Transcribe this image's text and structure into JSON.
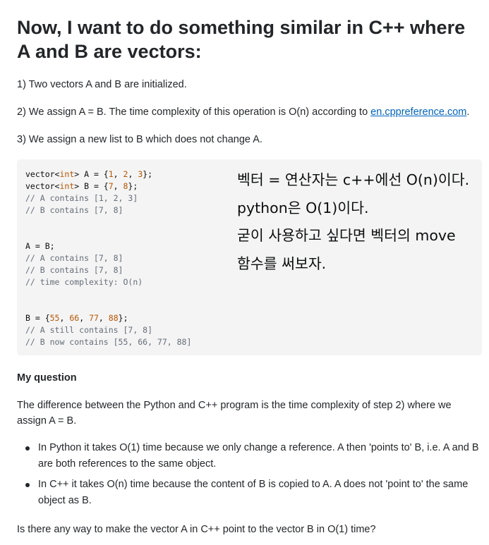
{
  "post": {
    "heading": "Now, I want to do something similar in C++ where A and B are vectors:",
    "steps": [
      "1) Two vectors A and B are initialized.",
      "2) We assign A = B. The time complexity of this operation is O(n) according to ",
      "3) We assign a new list to B which does not change A."
    ],
    "step2_link": "en.cppreference.com",
    "step2_suffix": ".",
    "code_lines": [
      [
        {
          "t": "vector<",
          "c": ""
        },
        {
          "t": "int",
          "c": "kw"
        },
        {
          "t": "> A = {",
          "c": ""
        },
        {
          "t": "1",
          "c": "num"
        },
        {
          "t": ", ",
          "c": ""
        },
        {
          "t": "2",
          "c": "num"
        },
        {
          "t": ", ",
          "c": ""
        },
        {
          "t": "3",
          "c": "num"
        },
        {
          "t": "};",
          "c": ""
        }
      ],
      [
        {
          "t": "vector<",
          "c": ""
        },
        {
          "t": "int",
          "c": "kw"
        },
        {
          "t": "> B = {",
          "c": ""
        },
        {
          "t": "7",
          "c": "num"
        },
        {
          "t": ", ",
          "c": ""
        },
        {
          "t": "8",
          "c": "num"
        },
        {
          "t": "};",
          "c": ""
        }
      ],
      [
        {
          "t": "// A contains [1, 2, 3]",
          "c": "cm"
        }
      ],
      [
        {
          "t": "// B contains [7, 8]",
          "c": "cm"
        }
      ],
      [],
      [],
      [
        {
          "t": "A = B;",
          "c": ""
        }
      ],
      [
        {
          "t": "// A contains [7, 8]",
          "c": "cm"
        }
      ],
      [
        {
          "t": "// B contains [7, 8]",
          "c": "cm"
        }
      ],
      [
        {
          "t": "// time complexity: O(n)",
          "c": "cm"
        }
      ],
      [],
      [],
      [
        {
          "t": "B = {",
          "c": ""
        },
        {
          "t": "55",
          "c": "num"
        },
        {
          "t": ", ",
          "c": ""
        },
        {
          "t": "66",
          "c": "num"
        },
        {
          "t": ", ",
          "c": ""
        },
        {
          "t": "77",
          "c": "num"
        },
        {
          "t": ", ",
          "c": ""
        },
        {
          "t": "88",
          "c": "num"
        },
        {
          "t": "};",
          "c": ""
        }
      ],
      [
        {
          "t": "// A still contains [7, 8]",
          "c": "cm"
        }
      ],
      [
        {
          "t": "// B now contains [55, 66, 77, 88]",
          "c": "cm"
        }
      ]
    ],
    "annotation_lines": [
      "벡터 = 연산자는 c++에선 O(n)이다.",
      "python은 O(1)이다.",
      "굳이 사용하고 싶다면 벡터의 move",
      "함수를 써보자."
    ],
    "question_heading": "My question",
    "question_body": "The difference between the Python and C++ program is the time complexity of step 2) where we assign A = B.",
    "bullets": [
      "In Python it takes O(1) time because we only change a reference. A then 'points to' B, i.e. A and B are both references to the same object.",
      "In C++ it takes O(n) time because the content of B is copied to A. A does not 'point to' the same object as B."
    ],
    "closing": "Is there any way to make the vector A in C++ point to the vector B in O(1) time?"
  },
  "colors": {
    "text": "#232629",
    "link": "#0063bf",
    "code_bg": "#f4f4f4",
    "code_keyword": "#b75501",
    "code_comment": "#656e77"
  }
}
